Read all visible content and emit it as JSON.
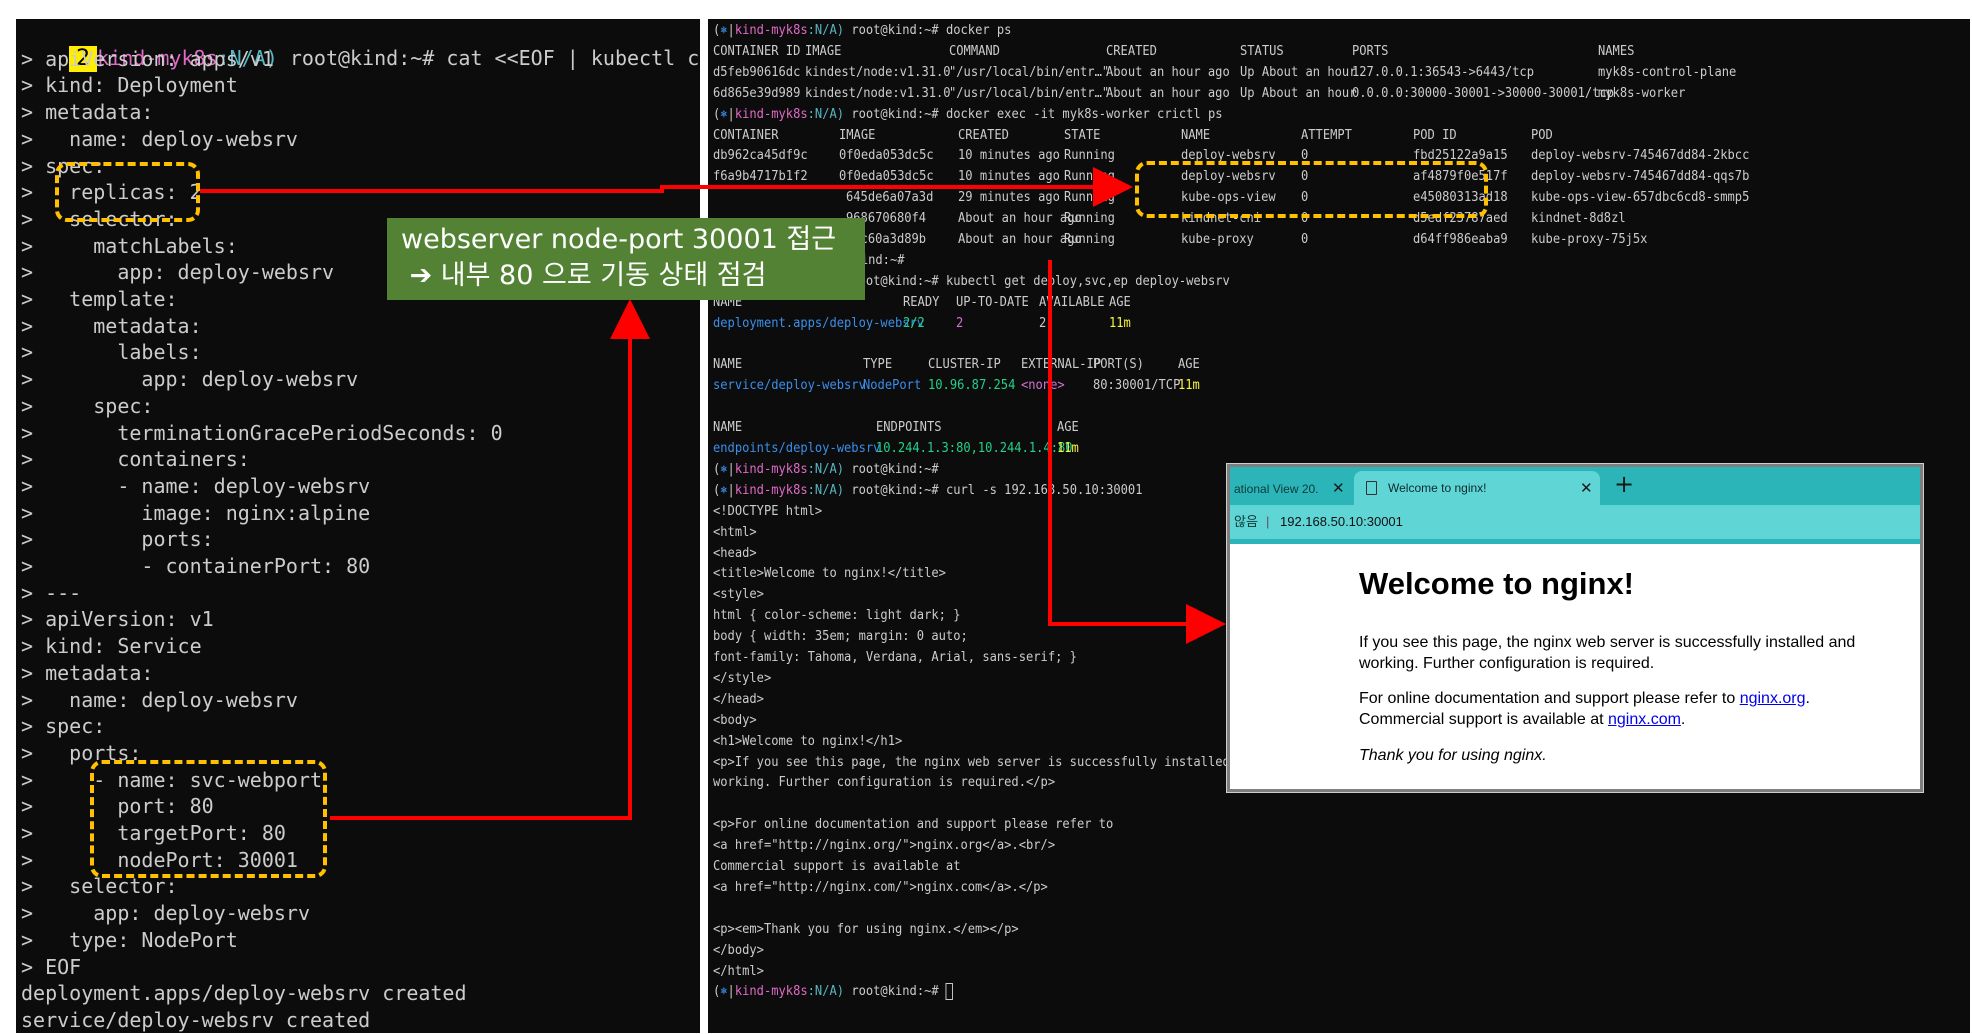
{
  "left_terminal": {
    "step_badge": "2",
    "prompt_ctx": "kind-myk8s",
    "prompt_ns": ":N/A)",
    "prompt_user": " root@kind:~# ",
    "command": "cat <<EOF | kubectl create -f",
    "lines": [
      "> apiVersion: apps/v1",
      "> kind: Deployment",
      "> metadata:",
      ">   name: deploy-websrv",
      "> spec:",
      ">   replicas: 2",
      ">   selector:",
      ">     matchLabels:",
      ">       app: deploy-websrv",
      ">   template:",
      ">     metadata:",
      ">       labels:",
      ">         app: deploy-websrv",
      ">     spec:",
      ">       terminationGracePeriodSeconds: 0",
      ">       containers:",
      ">       - name: deploy-websrv",
      ">         image: nginx:alpine",
      ">         ports:",
      ">         - containerPort: 80",
      "> ---",
      "> apiVersion: v1",
      "> kind: Service",
      "> metadata:",
      ">   name: deploy-websrv",
      "> spec:",
      ">   ports:",
      ">     - name: svc-webport",
      ">       port: 80",
      ">       targetPort: 80",
      ">       nodePort: 30001",
      ">   selector:",
      ">     app: deploy-websrv",
      ">   type: NodePort",
      "> EOF",
      "deployment.apps/deploy-websrv created",
      "service/deploy-websrv created"
    ]
  },
  "annotation": {
    "label": "webserver node-port 30001 접근\n ➔ 내부 80 으로 기동 상태 점검",
    "highlight_color": "#ffc000",
    "arrow_color": "#ff0000",
    "label_bg": "#548235"
  },
  "right_terminal": {
    "prompt": {
      "open": "(",
      "icon": "⎈",
      "sep": "|",
      "ctx": "kind-myk8s",
      "ns": ":N/A)",
      "user": " root@kind:~# "
    },
    "cmd_docker_ps": "docker ps",
    "docker_ps_headers": [
      "CONTAINER ID",
      "IMAGE",
      "COMMAND",
      "CREATED",
      "STATUS",
      "PORTS",
      "NAMES"
    ],
    "docker_ps_rows": [
      [
        "d5feb90616dc",
        "kindest/node:v1.31.0",
        "\"/usr/local/bin/entr…\"",
        "About an hour ago",
        "Up About an hour",
        "127.0.0.1:36543->6443/tcp",
        "myk8s-control-plane"
      ],
      [
        "6d865e39d989",
        "kindest/node:v1.31.0",
        "\"/usr/local/bin/entr…\"",
        "About an hour ago",
        "Up About an hour",
        "0.0.0.0:30000-30001->30000-30001/tcp",
        "myk8s-worker"
      ]
    ],
    "cmd_crictl": "docker exec -it myk8s-worker crictl ps",
    "crictl_headers": [
      "CONTAINER",
      "IMAGE",
      "CREATED",
      "STATE",
      "NAME",
      "ATTEMPT",
      "POD ID",
      "POD"
    ],
    "crictl_rows": [
      [
        "db962ca45df9c",
        "0f0eda053dc5c",
        "10 minutes ago",
        "Running",
        "deploy-websrv",
        "0",
        "fbd25122a9a15",
        "deploy-websrv-745467dd84-2kbcc"
      ],
      [
        "f6a9b4717b1f2",
        "0f0eda053dc5c",
        "10 minutes ago",
        "Running",
        "deploy-websrv",
        "0",
        "af4879f0e517f",
        "deploy-websrv-745467dd84-qqs7b"
      ],
      [
        "",
        "645de6a07a3d",
        "29 minutes ago",
        "Running",
        "kube-ops-view",
        "0",
        "e45080313ad18",
        "kube-ops-view-657dbc6cd8-smmp5"
      ],
      [
        "",
        "968670680f4",
        "About an hour ago",
        "Running",
        "kindnet-cni",
        "0",
        "d5edf23787aed",
        "kindnet-8d8zl"
      ],
      [
        "",
        "3ec60a3d89b",
        "About an hour ago",
        "Running",
        "kube-proxy",
        "0",
        "d64ff986eaba9",
        "kube-proxy-75j5x"
      ]
    ],
    "partial_prompt": "t@kind:~#",
    "cmd_get": "kubectl get deploy,svc,ep deploy-websrv",
    "deploy_headers": [
      "NAME",
      "READY",
      "UP-TO-DATE",
      "AVAILABLE",
      "AGE"
    ],
    "deploy_row": [
      "deployment.apps/deploy-websrv",
      "2/2",
      "2",
      "2",
      "11m"
    ],
    "svc_headers": [
      "NAME",
      "TYPE",
      "CLUSTER-IP",
      "EXTERNAL-IP",
      "PORT(S)",
      "AGE"
    ],
    "svc_row": [
      "service/deploy-websrv",
      "NodePort",
      "10.96.87.254",
      "<none>",
      "80:30001/TCP",
      "11m"
    ],
    "ep_headers": [
      "NAME",
      "ENDPOINTS",
      "AGE"
    ],
    "ep_row": [
      "endpoints/deploy-websrv",
      "10.244.1.3:80,10.244.1.4:80",
      "11m"
    ],
    "cmd_curl": "curl -s 192.168.50.10:30001",
    "curl_output": [
      "<!DOCTYPE html>",
      "<html>",
      "<head>",
      "<title>Welcome to nginx!</title>",
      "<style>",
      "html { color-scheme: light dark; }",
      "body { width: 35em; margin: 0 auto;",
      "font-family: Tahoma, Verdana, Arial, sans-serif; }",
      "</style>",
      "</head>",
      "<body>",
      "<h1>Welcome to nginx!</h1>",
      "<p>If you see this page, the nginx web server is successfully installed and",
      "working. Further configuration is required.</p>",
      "",
      "<p>For online documentation and support please refer to",
      "<a href=\"http://nginx.org/\">nginx.org</a>.<br/>",
      "Commercial support is available at",
      "<a href=\"http://nginx.com/\">nginx.com</a>.</p>",
      "",
      "<p><em>Thank you for using nginx.</em></p>",
      "</body>",
      "</html>"
    ]
  },
  "browser": {
    "inactive_tab": "ational View 20.",
    "active_tab": "Welcome to nginx!",
    "close_glyph": "✕",
    "new_tab_glyph": "+",
    "security_label": "않음",
    "address_sep": "|",
    "url": "192.168.50.10:30001",
    "heading": "Welcome to nginx!",
    "para1": "If you see this page, the nginx web server is successfully installed and working. Further configuration is required.",
    "para2_prefix": "For online documentation and support please refer to ",
    "link1": "nginx.org",
    "para2_mid": ".",
    "para2_line2": "Commercial support is available at ",
    "link2": "nginx.com",
    "para2_end": ".",
    "thanks": "Thank you for using nginx."
  }
}
